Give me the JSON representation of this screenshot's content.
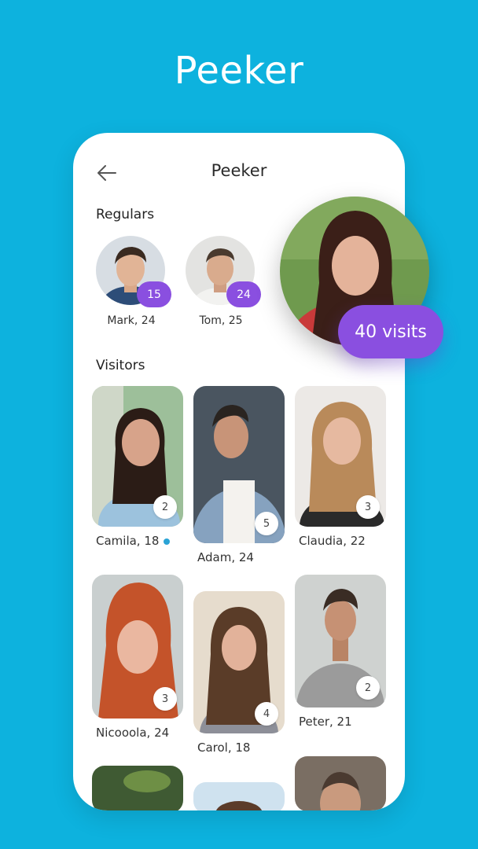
{
  "hero": {
    "title": "Peeker"
  },
  "topbar": {
    "title": "Peeker",
    "back_icon": "arrow-left-icon"
  },
  "regulars": {
    "title": "Regulars",
    "items": [
      {
        "name": "Mark, 24",
        "count": "15"
      },
      {
        "name": "Tom, 25",
        "count": "24"
      }
    ]
  },
  "visitors": {
    "title": "Visitors",
    "items": [
      {
        "name": "Camila, 18",
        "count": "2",
        "online": true
      },
      {
        "name": "Adam, 24",
        "count": "5"
      },
      {
        "name": "Claudia, 22",
        "count": "3"
      },
      {
        "name": "Nicooola, 24",
        "count": "3"
      },
      {
        "name": "Carol, 18",
        "count": "4"
      },
      {
        "name": "Peter, 21",
        "count": "2"
      }
    ]
  },
  "featured": {
    "visits_label": "40 visits"
  },
  "colors": {
    "background": "#0db2de",
    "accent": "#8a4fe0",
    "card": "#ffffff"
  }
}
